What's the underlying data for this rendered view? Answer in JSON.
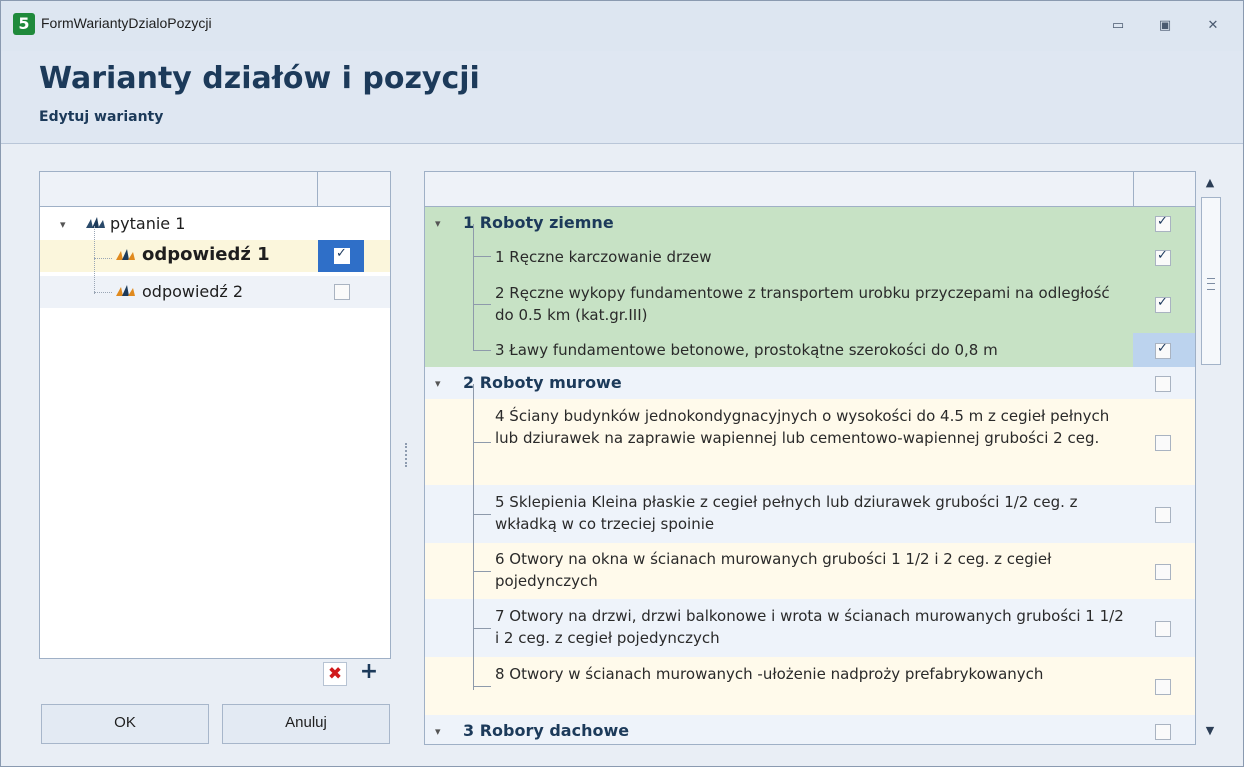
{
  "window": {
    "title": "FormWariantyDzialoPozycji",
    "app_icon_label": "5"
  },
  "header": {
    "title": "Warianty działów i pozycji",
    "subtitle": "Edytuj warianty"
  },
  "left_tree": {
    "root": {
      "label": "pytanie 1",
      "expanded": true
    },
    "items": [
      {
        "label": "odpowiedź 1",
        "checked": true,
        "selected": true
      },
      {
        "label": "odpowiedź 2",
        "checked": false,
        "selected": false
      }
    ]
  },
  "left_toolbar": {
    "delete_icon": "delete-x-icon",
    "add_icon": "plus-icon"
  },
  "buttons": {
    "ok": "OK",
    "cancel": "Anuluj"
  },
  "right_tree": {
    "groups": [
      {
        "label": "1 Roboty ziemne",
        "checked": true
      },
      {
        "label": "2 Roboty murowe",
        "checked": false
      },
      {
        "label": "3 Robory dachowe",
        "checked": false
      }
    ],
    "items": [
      {
        "label": "1 Ręczne karczowanie drzew",
        "checked": true
      },
      {
        "label": "2 Ręczne wykopy fundamentowe z transportem urobku przyczepami na odległość do 0.5 km (kat.gr.III)",
        "checked": true
      },
      {
        "label": "3 Ławy fundamentowe betonowe, prostokątne szerokości do 0,8 m",
        "checked": true
      },
      {
        "label": "4 Ściany budynków jednokondygnacyjnych o wysokości do 4.5 m z cegieł pełnych lub dziurawek na zaprawie wapiennej lub cementowo-wapiennej grubości 2 ceg.",
        "checked": false
      },
      {
        "label": "5 Sklepienia Kleina płaskie z cegieł pełnych lub dziurawek grubości 1/2 ceg. z wkładką w co trzeciej spoinie",
        "checked": false
      },
      {
        "label": "6 Otwory na okna w ścianach murowanych grubości 1 1/2 i 2 ceg. z cegieł pojedynczych",
        "checked": false
      },
      {
        "label": "7 Otwory na drzwi, drzwi balkonowe i wrota w ścianach murowanych grubości 1 1/2 i 2 ceg. z cegieł pojedynczych",
        "checked": false
      },
      {
        "label": "8 Otwory w ścianach murowanych -ułożenie nadproży prefabrykowanych",
        "checked": false
      }
    ]
  }
}
